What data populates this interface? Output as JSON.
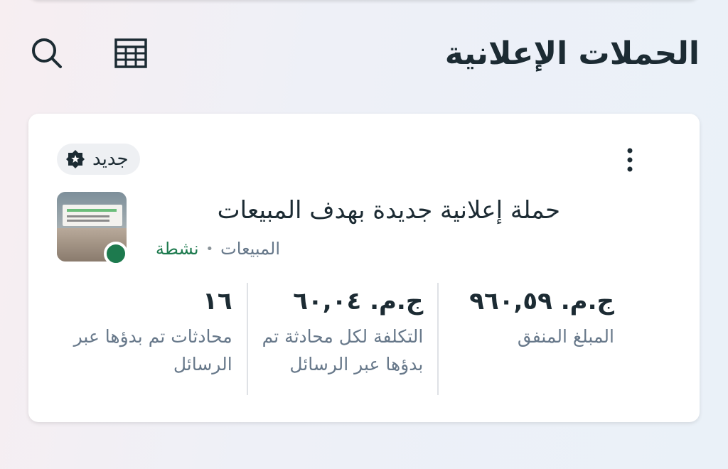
{
  "page": {
    "title": "الحملات الإعلانية"
  },
  "header": {
    "search_icon": "search-icon",
    "table_icon": "table-view-icon"
  },
  "campaign": {
    "badge_label": "جديد",
    "badge_icon": "star-badge-icon",
    "name": "حملة إعلانية جديدة بهدف المبيعات",
    "status": "نشطة",
    "separator": "•",
    "objective": "المبيعات",
    "menu_icon": "more-vert-icon",
    "status_color": "#1d7a4e",
    "metrics": [
      {
        "value": "ج.م. ٩٦٠,٥٩",
        "label": "المبلغ المنفق"
      },
      {
        "value": "ج.م. ٦٠,٠٤",
        "label": "التكلفة لكل محادثة تم بدؤها عبر الرسائل"
      },
      {
        "value": "١٦",
        "label": "محادثات تم بدؤها عبر الرسائل"
      }
    ]
  }
}
